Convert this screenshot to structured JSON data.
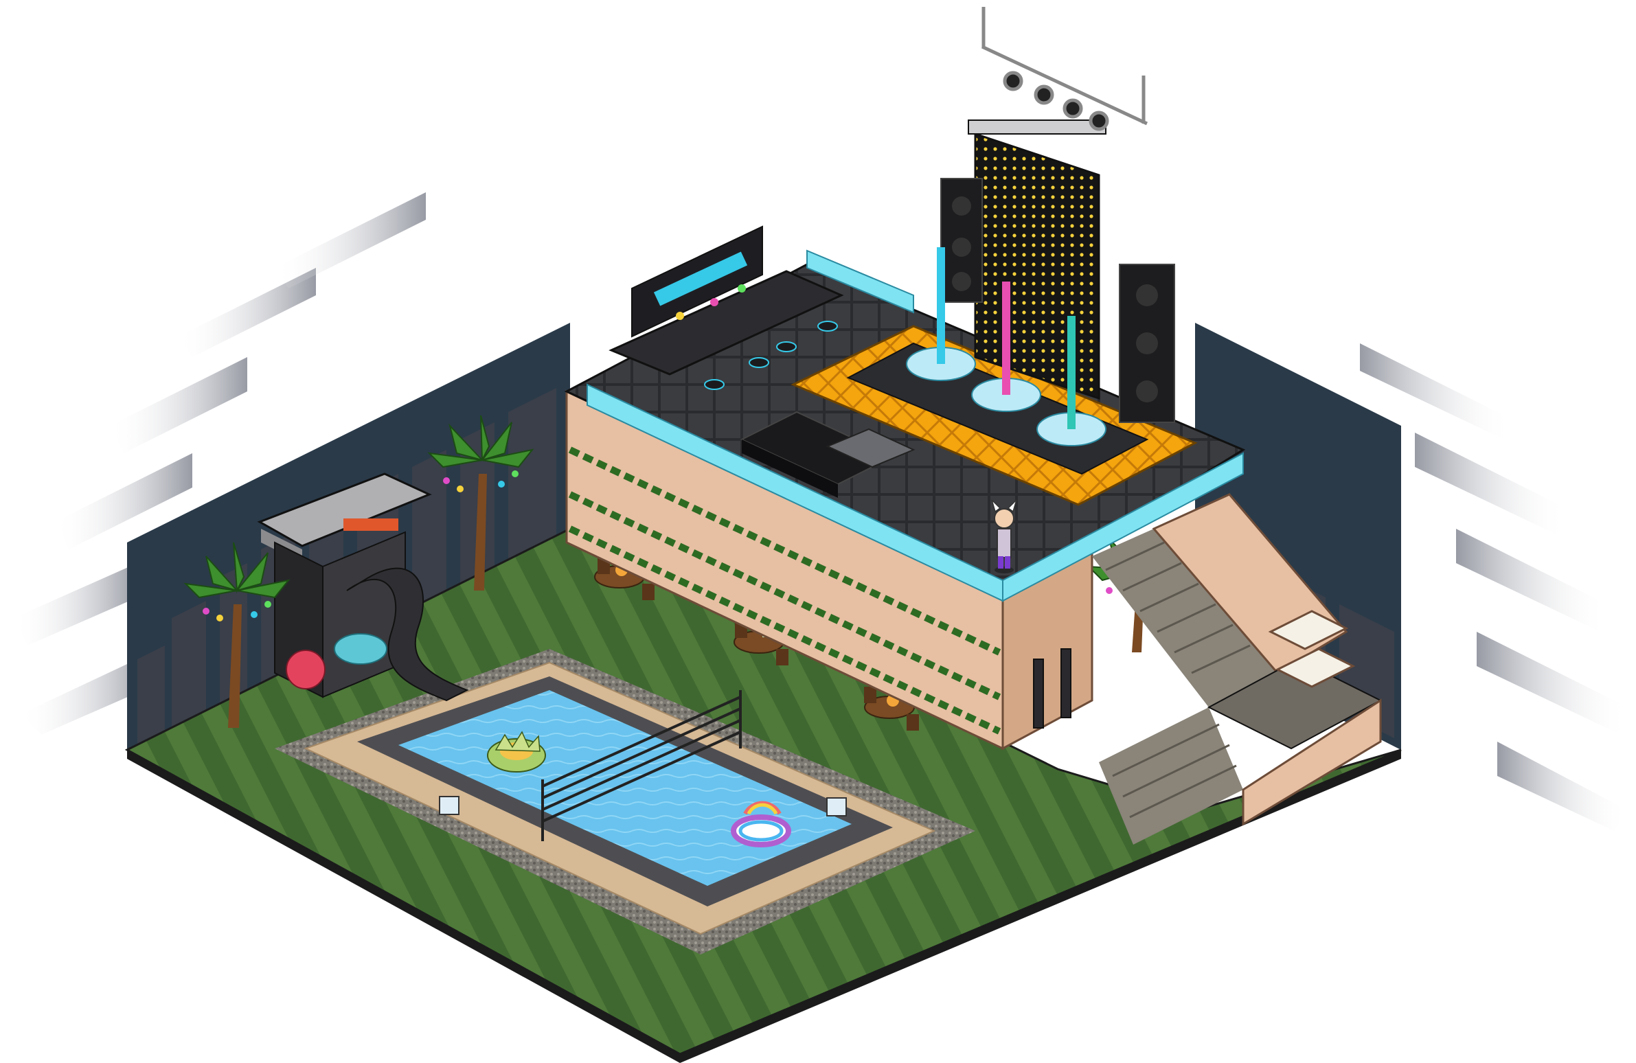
{
  "scene": {
    "kind": "isometric-room",
    "visible_text": [],
    "regions": [
      {
        "id": "lawn",
        "name": "lawn-floor",
        "surface": "striped-grass"
      },
      {
        "id": "pool",
        "name": "swimming-pool",
        "surface": "water"
      },
      {
        "id": "terrace",
        "name": "raised-terrace",
        "surface": "dark-tiles"
      },
      {
        "id": "stage",
        "name": "stage-platform",
        "surface": "orange-truss"
      },
      {
        "id": "stairs",
        "name": "staircase",
        "surface": "stone"
      }
    ],
    "objects": [
      {
        "name": "bar-counter",
        "icon": "bar-icon"
      },
      {
        "name": "led-wall",
        "icon": "screen-icon"
      },
      {
        "name": "speaker-stack-left",
        "icon": "speaker-icon"
      },
      {
        "name": "speaker-stack-right",
        "icon": "speaker-icon"
      },
      {
        "name": "stage-light-rig",
        "icon": "spotlight-icon"
      },
      {
        "name": "dance-pole-cyan",
        "icon": "pole-icon"
      },
      {
        "name": "dance-pole-pink",
        "icon": "pole-icon"
      },
      {
        "name": "dance-pole-teal",
        "icon": "pole-icon"
      },
      {
        "name": "black-sofa",
        "icon": "sofa-icon"
      },
      {
        "name": "avatar",
        "icon": "avatar-icon"
      },
      {
        "name": "waterslide",
        "icon": "slide-icon"
      },
      {
        "name": "slide-tower",
        "icon": "tower-icon"
      },
      {
        "name": "palm-tree-left",
        "icon": "palm-icon"
      },
      {
        "name": "palm-tree-center",
        "icon": "palm-icon"
      },
      {
        "name": "palm-tree-right",
        "icon": "palm-icon"
      },
      {
        "name": "lotus-float",
        "icon": "lotus-icon"
      },
      {
        "name": "rainbow-float",
        "icon": "rainbow-icon"
      },
      {
        "name": "volleyball-net",
        "icon": "net-icon"
      },
      {
        "name": "cafe-table-1",
        "icon": "table-icon"
      },
      {
        "name": "cafe-table-2",
        "icon": "table-icon"
      },
      {
        "name": "cafe-table-3",
        "icon": "table-icon"
      },
      {
        "name": "lounge-sofa",
        "icon": "sofa-icon"
      }
    ],
    "colors": {
      "grass_light": "#4f7a3a",
      "grass_dark": "#355a26",
      "water": "#69c3ee",
      "water_deep": "#4aa8de",
      "pool_tile": "#d6b995",
      "pool_rim": "#4e4e52",
      "gravel": "#8a8780",
      "terrace_wall": "#e7bfa2",
      "terrace_top": "#3b3c40",
      "stage_orange": "#f5a50d",
      "glass_cyan": "#7fe3f2",
      "city_sky": "#2a3a49",
      "building": "#3a3f4a",
      "led_yellow": "#f6d23c",
      "pole_cyan": "#36c9e8",
      "pole_pink": "#e84fb0",
      "outline": "#111111"
    }
  }
}
